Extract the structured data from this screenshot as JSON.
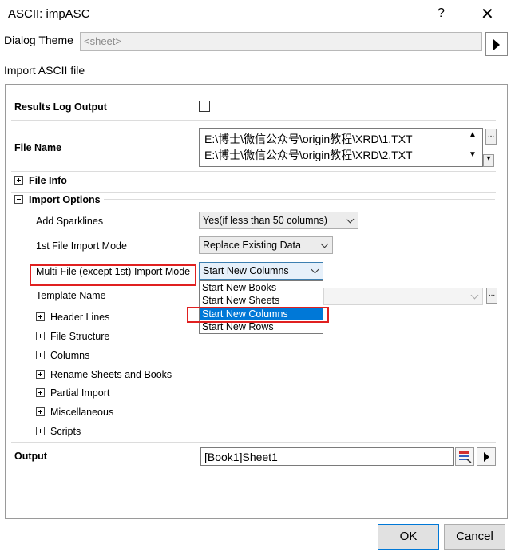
{
  "window": {
    "title": "ASCII: impASC",
    "help": "?",
    "close": "✕"
  },
  "theme": {
    "label": "Dialog Theme",
    "value": "<sheet>"
  },
  "section_title": "Import ASCII file",
  "results_log": {
    "label": "Results Log Output",
    "checked": false
  },
  "file_name": {
    "label": "File Name",
    "files": [
      "E:\\博士\\微信公众号\\origin教程\\XRD\\1.TXT",
      "E:\\博士\\微信公众号\\origin教程\\XRD\\2.TXT"
    ],
    "browse": "..."
  },
  "file_info": {
    "label": "File Info"
  },
  "import_options": {
    "label": "Import Options",
    "add_sparklines": {
      "label": "Add Sparklines",
      "value": "Yes(if less than 50 columns)"
    },
    "first_file_mode": {
      "label": "1st File Import Mode",
      "value": "Replace Existing Data"
    },
    "multi_file_mode": {
      "label": "Multi-File (except 1st) Import Mode",
      "value": "Start New Columns",
      "options": [
        "Start New Books",
        "Start New Sheets",
        "Start New Columns",
        "Start New Rows"
      ],
      "highlighted": "Start New Columns"
    },
    "template_name": {
      "label": "Template Name",
      "browse": "..."
    }
  },
  "subsections": [
    "Header Lines",
    "File Structure",
    "Columns",
    "Rename Sheets and Books",
    "Partial Import",
    "Miscellaneous",
    "Scripts"
  ],
  "output": {
    "label": "Output",
    "value": "[Book1]Sheet1"
  },
  "buttons": {
    "ok": "OK",
    "cancel": "Cancel"
  }
}
